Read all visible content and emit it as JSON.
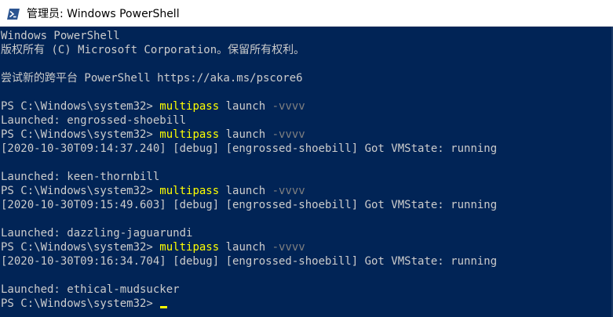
{
  "window": {
    "title": "管理员: Windows PowerShell",
    "icon": "powershell-icon",
    "colors": {
      "console_bg": "#012456",
      "text": "#cccccc",
      "command": "#ffff00",
      "parameter": "#808080"
    }
  },
  "console": {
    "lines": [
      {
        "text": "Windows PowerShell"
      },
      {
        "text": "版权所有 (C) Microsoft Corporation。保留所有权利。"
      },
      {
        "text": ""
      },
      {
        "text": "尝试新的跨平台 PowerShell https://aka.ms/pscore6"
      },
      {
        "text": ""
      },
      {
        "prompt": "PS C:\\Windows\\system32> ",
        "command": "multipass",
        "args": " launch ",
        "param": "-vvvv"
      },
      {
        "text": "Launched: engrossed-shoebill"
      },
      {
        "prompt": "PS C:\\Windows\\system32> ",
        "command": "multipass",
        "args": " launch ",
        "param": "-vvvv"
      },
      {
        "text": "[2020-10-30T09:14:37.240] [debug] [engrossed-shoebill] Got VMState: running"
      },
      {
        "text": ""
      },
      {
        "text": "Launched: keen-thornbill"
      },
      {
        "prompt": "PS C:\\Windows\\system32> ",
        "command": "multipass",
        "args": " launch ",
        "param": "-vvvv"
      },
      {
        "text": "[2020-10-30T09:15:49.603] [debug] [engrossed-shoebill] Got VMState: running"
      },
      {
        "text": ""
      },
      {
        "text": "Launched: dazzling-jaguarundi"
      },
      {
        "prompt": "PS C:\\Windows\\system32> ",
        "command": "multipass",
        "args": " launch ",
        "param": "-vvvv"
      },
      {
        "text": "[2020-10-30T09:16:34.704] [debug] [engrossed-shoebill] Got VMState: running"
      },
      {
        "text": ""
      },
      {
        "text": "Launched: ethical-mudsucker"
      },
      {
        "prompt": "PS C:\\Windows\\system32> ",
        "cursor": true
      }
    ]
  }
}
